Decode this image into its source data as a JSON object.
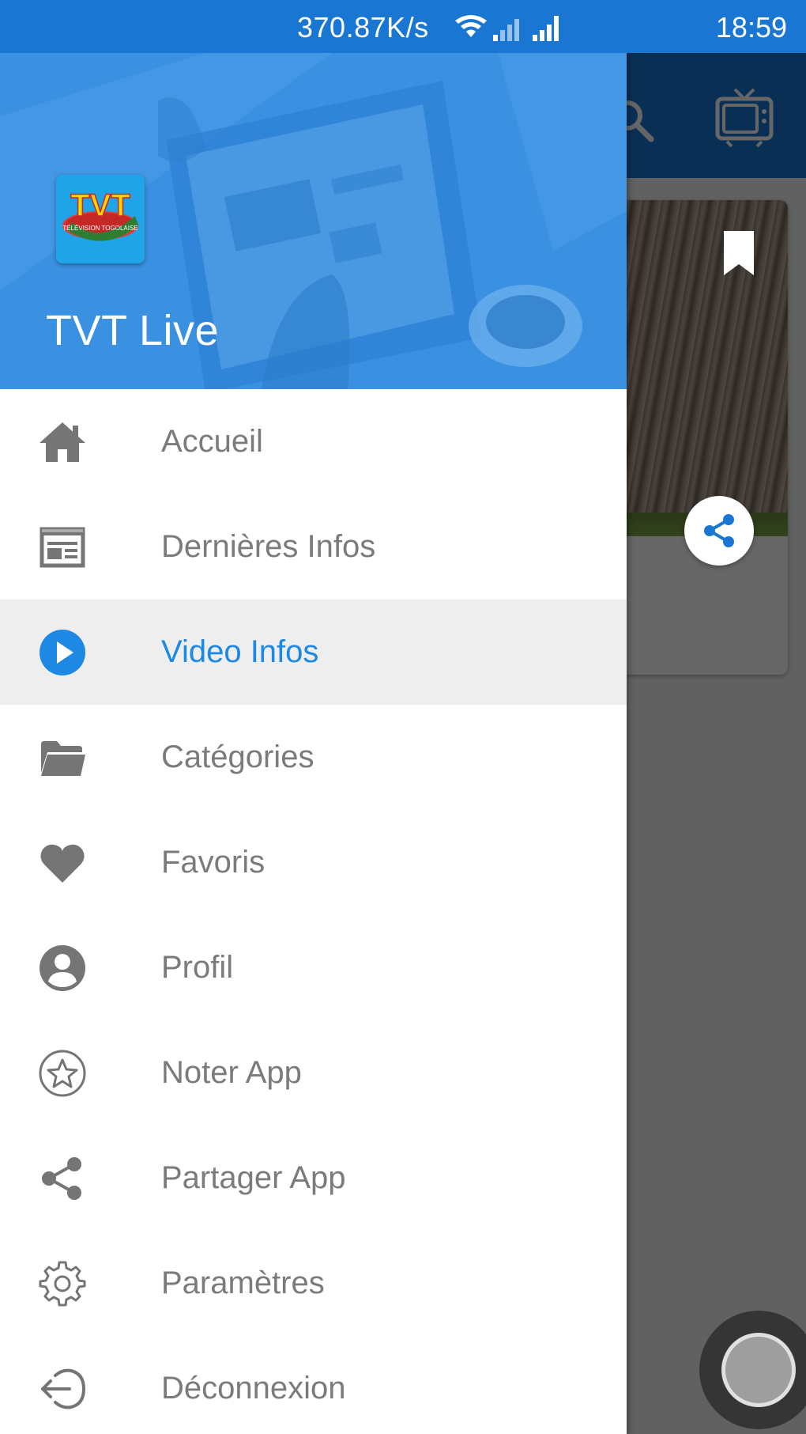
{
  "status_bar": {
    "network_speed": "370.87K/s",
    "time": "18:59",
    "icons": [
      "wifi-icon",
      "signal-icon",
      "signal-icon"
    ]
  },
  "drawer": {
    "app_title": "TVT Live",
    "logo_text": "TVT",
    "active_item": "Video Infos",
    "items": [
      {
        "label": "Accueil",
        "icon": "home-icon"
      },
      {
        "label": "Dernières Infos",
        "icon": "newspaper-icon"
      },
      {
        "label": "Video Infos",
        "icon": "play-circle-icon"
      },
      {
        "label": "Catégories",
        "icon": "folder-icon"
      },
      {
        "label": "Favoris",
        "icon": "heart-icon"
      },
      {
        "label": "Profil",
        "icon": "account-circle-icon"
      },
      {
        "label": "Noter App",
        "icon": "star-circle-icon"
      },
      {
        "label": "Partager App",
        "icon": "share-icon"
      },
      {
        "label": "Paramètres",
        "icon": "gear-icon"
      },
      {
        "label": "Déconnexion",
        "icon": "logout-icon"
      }
    ]
  },
  "background_screen": {
    "toolbar_icons": [
      "search-icon",
      "tv-icon"
    ],
    "card_icons": [
      "bookmark-icon",
      "share-icon"
    ]
  },
  "colors": {
    "primary": "#1976d2",
    "accent": "#1e88e5",
    "menu_text": "#7b7b7b",
    "menu_icon": "#757575",
    "active_background": "#eeeeee"
  }
}
